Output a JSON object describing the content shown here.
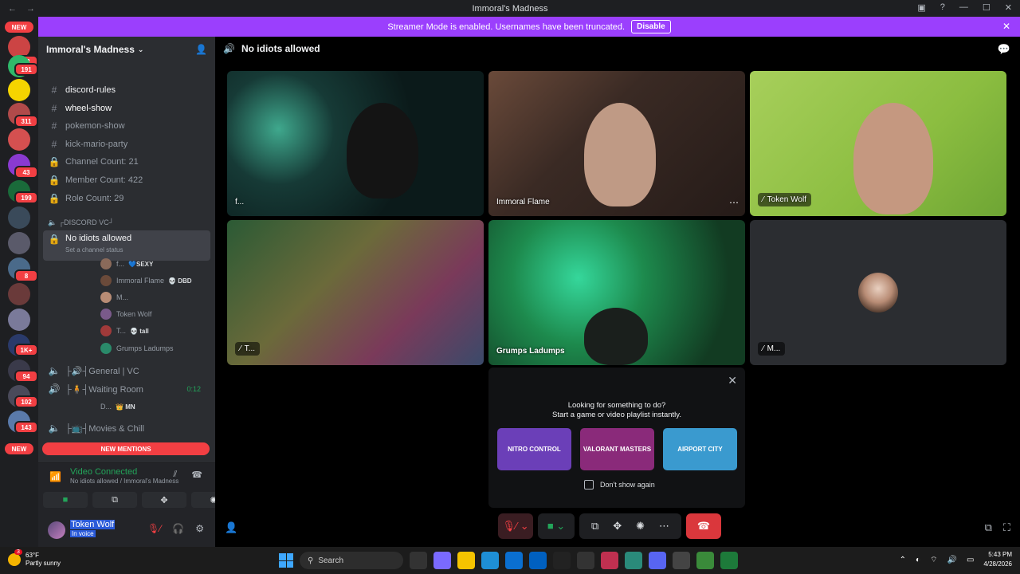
{
  "window": {
    "title": "Immoral's Madness",
    "nav_back": "←",
    "nav_forward": "→"
  },
  "banner": {
    "text": "Streamer Mode is enabled. Usernames have been truncated.",
    "button": "Disable"
  },
  "rail": {
    "new_top": "NEW",
    "new_bottom": "NEW",
    "badges": [
      "43",
      "191",
      "311",
      "43",
      "199",
      "8",
      "1K+",
      "94",
      "102",
      "143"
    ]
  },
  "sidebar": {
    "server_name": "Immoral's Madness",
    "channels": [
      {
        "name": "discord-rules",
        "icon": "#"
      },
      {
        "name": "wheel-show",
        "icon": "#"
      },
      {
        "name": "pokemon-show",
        "icon": "#"
      },
      {
        "name": "kick-mario-party",
        "icon": "#"
      },
      {
        "name": "Channel Count: 21",
        "icon": "lock"
      },
      {
        "name": "Member Count: 422",
        "icon": "lock"
      },
      {
        "name": "Role Count: 29",
        "icon": "lock"
      }
    ],
    "category": "┌DISCORD VC┘",
    "selected_channel": "No idiots allowed",
    "selected_status": "Set a channel status",
    "voice_users": [
      {
        "name": "f...",
        "tag": "💙SEXY",
        "color": "#8a6a5a"
      },
      {
        "name": "Immoral Flame",
        "tag": "💀 DBD",
        "color": "#6a4a3a"
      },
      {
        "name": "M...",
        "tag": "",
        "color": "#b88c75"
      },
      {
        "name": "Token Wolf",
        "tag": "",
        "color": "#7a5a8a"
      },
      {
        "name": "T...",
        "tag": "💀 tall",
        "color": "#a03a3a"
      },
      {
        "name": "Grumps Ladumps",
        "tag": "",
        "color": "#2a8a6a"
      }
    ],
    "other_channels": [
      {
        "name": "├🔊┤General | VC"
      },
      {
        "name": "├🧍┤Waiting Room",
        "timer": "0:12"
      },
      {
        "name": "├📺┤Movies & Chill"
      }
    ],
    "waiting_user": {
      "name": "D...",
      "tag": "👑 MN"
    },
    "new_mentions": "NEW MENTIONS"
  },
  "voice_panel": {
    "status": "Video Connected",
    "location": "No idiots allowed / Immoral's Madness"
  },
  "user_panel": {
    "name": "Token Wolf",
    "status": "In voice"
  },
  "stage": {
    "channel_name": "No idiots allowed",
    "tiles": [
      {
        "label": "f...",
        "muted": false
      },
      {
        "label": "Immoral Flame",
        "muted": false
      },
      {
        "label": "Token Wolf",
        "muted": true
      },
      {
        "label": "T...",
        "muted": true
      },
      {
        "label": "Grumps Ladumps",
        "muted": false
      },
      {
        "label": "M...",
        "muted": true
      }
    ]
  },
  "activity": {
    "line1": "Looking for something to do?",
    "line2": "Start a game or video playlist instantly.",
    "games": [
      {
        "name": "NITRO CONTROL",
        "color": "#6b3fb8"
      },
      {
        "name": "VALORANT MASTERS",
        "color": "#8a2a7a"
      },
      {
        "name": "AIRPORT CITY",
        "color": "#3a9acf"
      }
    ],
    "dont_show": "Don't show again"
  },
  "taskbar": {
    "temp": "63°F",
    "weather": "Partly sunny",
    "weather_badge": "3",
    "search": "Search",
    "time": "5:43 PM",
    "date": "4/28/2026"
  }
}
